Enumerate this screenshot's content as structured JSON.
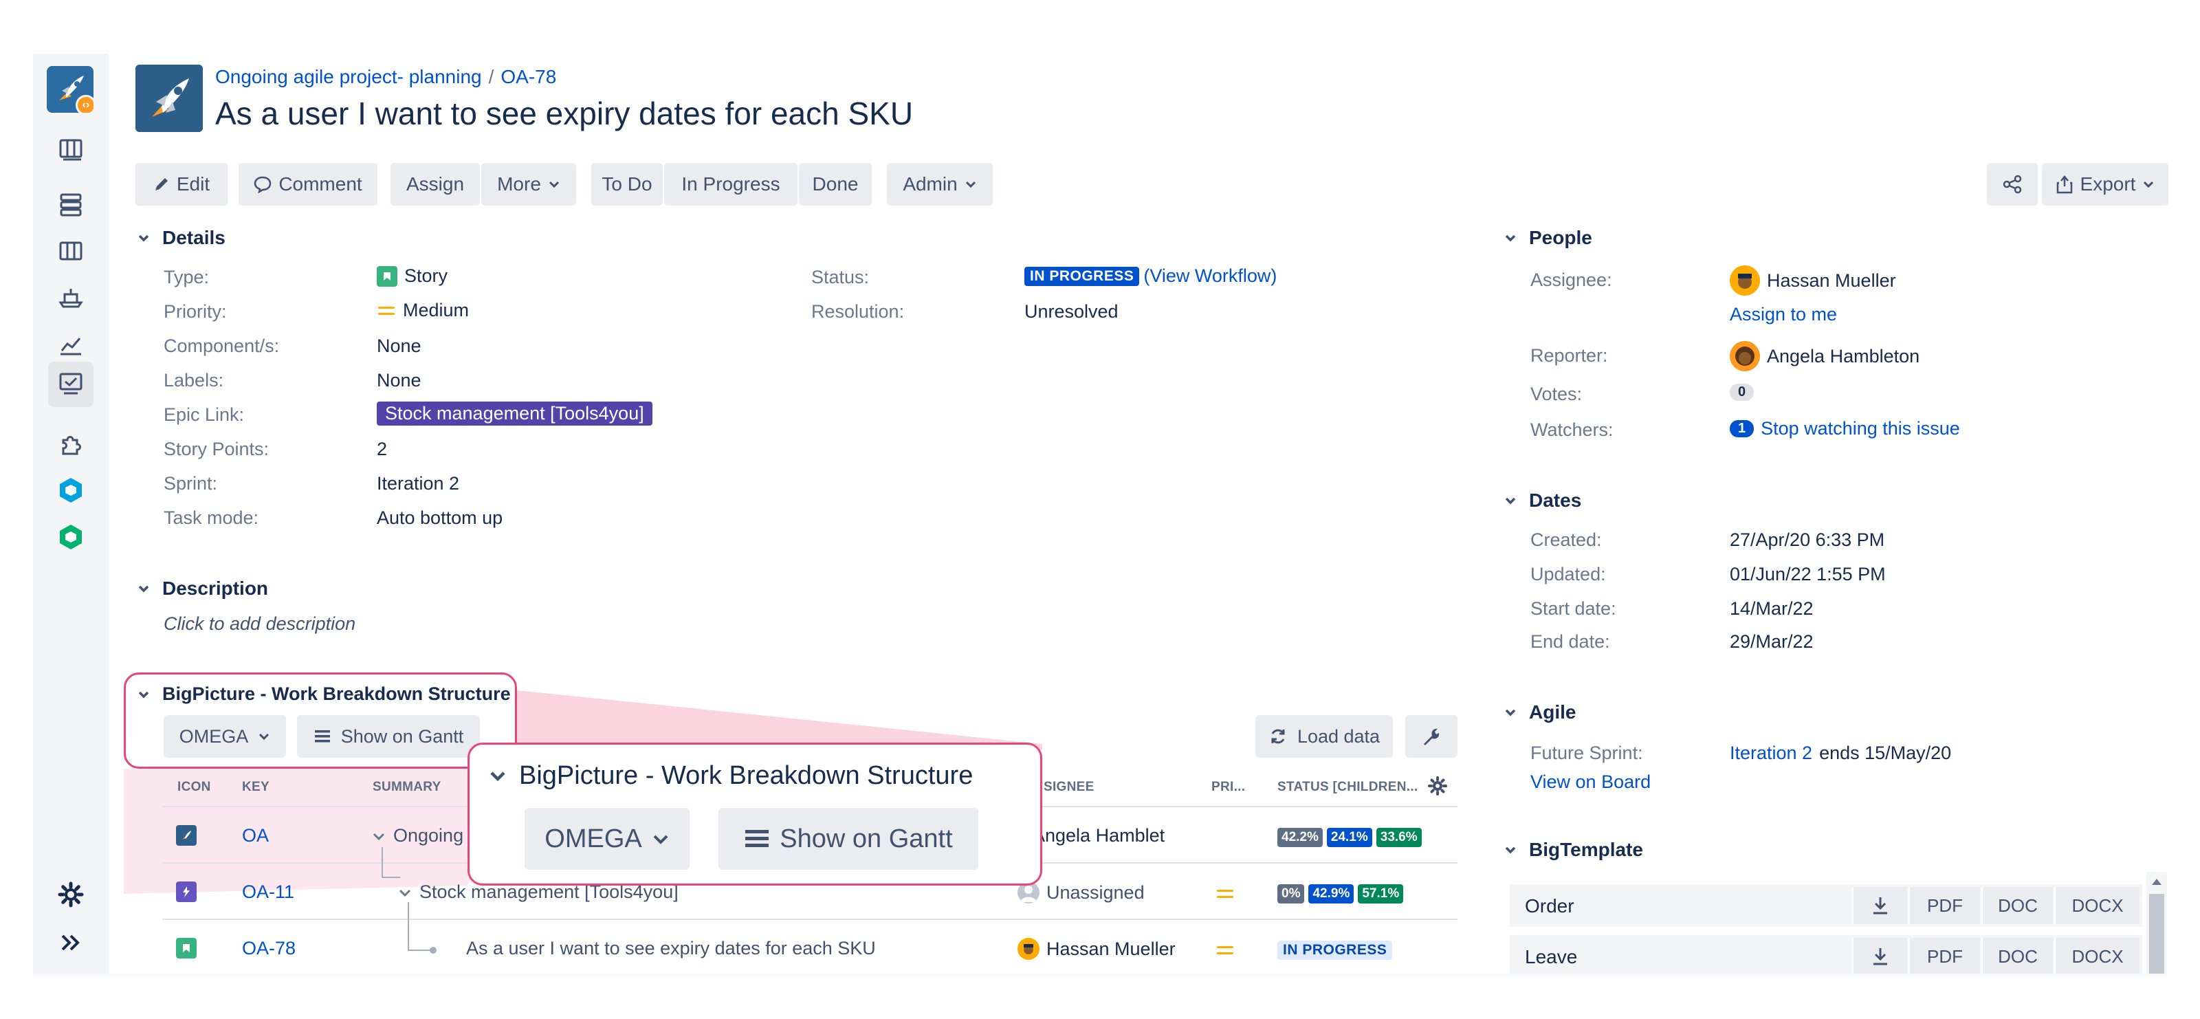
{
  "breadcrumb": {
    "project": "Ongoing agile project- planning",
    "separator": "/",
    "issue_key": "OA-78"
  },
  "title": "As a user I want to see expiry dates for each SKU",
  "toolbar": {
    "edit": "Edit",
    "comment": "Comment",
    "assign": "Assign",
    "more": "More",
    "todo": "To Do",
    "in_progress": "In Progress",
    "done": "Done",
    "admin": "Admin",
    "export": "Export"
  },
  "details": {
    "heading": "Details",
    "labels": {
      "type": "Type:",
      "priority": "Priority:",
      "components": "Component/s:",
      "labels": "Labels:",
      "epic_link": "Epic Link:",
      "story_points": "Story Points:",
      "sprint": "Sprint:",
      "task_mode": "Task mode:",
      "status": "Status:",
      "resolution": "Resolution:"
    },
    "values": {
      "type": "Story",
      "priority": "Medium",
      "components": "None",
      "labels": "None",
      "epic_link": "Stock management [Tools4you]",
      "story_points": "2",
      "sprint": "Iteration 2",
      "task_mode": "Auto bottom up",
      "status": "IN PROGRESS",
      "view_workflow": "(View Workflow)",
      "resolution": "Unresolved"
    }
  },
  "description": {
    "heading": "Description",
    "placeholder": "Click to add description"
  },
  "wbs": {
    "heading": "BigPicture - Work Breakdown Structure",
    "dropdown": "OMEGA",
    "show_gantt": "Show on Gantt",
    "load_data": "Load data",
    "columns": {
      "icon": "ICON",
      "key": "KEY",
      "summary": "SUMMARY",
      "assignee": "ASSIGNEE",
      "priority": "PRI...",
      "status": "STATUS [CHILDREN..."
    },
    "rows": [
      {
        "key": "OA",
        "summary": "Ongoing agile project- planning",
        "assignee": "Angela Hamblet",
        "pcts": [
          "42.2%",
          "24.1%",
          "33.6%"
        ]
      },
      {
        "key": "OA-11",
        "summary": "Stock management [Tools4you]",
        "assignee": "Unassigned",
        "pcts": [
          "0%",
          "42.9%",
          "57.1%"
        ]
      },
      {
        "key": "OA-78",
        "summary": "As a user I want to see expiry dates for each SKU",
        "assignee": "Hassan Mueller",
        "status": "IN PROGRESS"
      }
    ]
  },
  "zoom": {
    "heading": "BigPicture - Work Breakdown Structure",
    "dropdown": "OMEGA",
    "show_gantt": "Show on Gantt",
    "partial_column": "SIGNEE"
  },
  "people": {
    "heading": "People",
    "assignee_label": "Assignee:",
    "assignee": "Hassan Mueller",
    "assign_to_me": "Assign to me",
    "reporter_label": "Reporter:",
    "reporter": "Angela Hambleton",
    "votes_label": "Votes:",
    "votes": "0",
    "watchers_label": "Watchers:",
    "watchers_count": "1",
    "stop_watching": "Stop watching this issue"
  },
  "dates": {
    "heading": "Dates",
    "created_label": "Created:",
    "created": "27/Apr/20 6:33 PM",
    "updated_label": "Updated:",
    "updated": "01/Jun/22 1:55 PM",
    "start_label": "Start date:",
    "start": "14/Mar/22",
    "end_label": "End date:",
    "end": "29/Mar/22"
  },
  "agile": {
    "heading": "Agile",
    "future_sprint_label": "Future Sprint:",
    "sprint_link": "Iteration 2",
    "sprint_suffix": "ends 15/May/20",
    "view_on_board": "View on Board"
  },
  "bigtemplate": {
    "heading": "BigTemplate",
    "rows": [
      {
        "name": "Order",
        "pdf": "PDF",
        "doc": "DOC",
        "docx": "DOCX"
      },
      {
        "name": "Leave",
        "pdf": "PDF",
        "doc": "DOC",
        "docx": "DOCX"
      }
    ]
  },
  "colors": {
    "accent": "#0052cc",
    "highlight": "#e8467a",
    "epic": "#5243aa",
    "story": "#36b37e",
    "medium_priority": "#ffab00"
  }
}
